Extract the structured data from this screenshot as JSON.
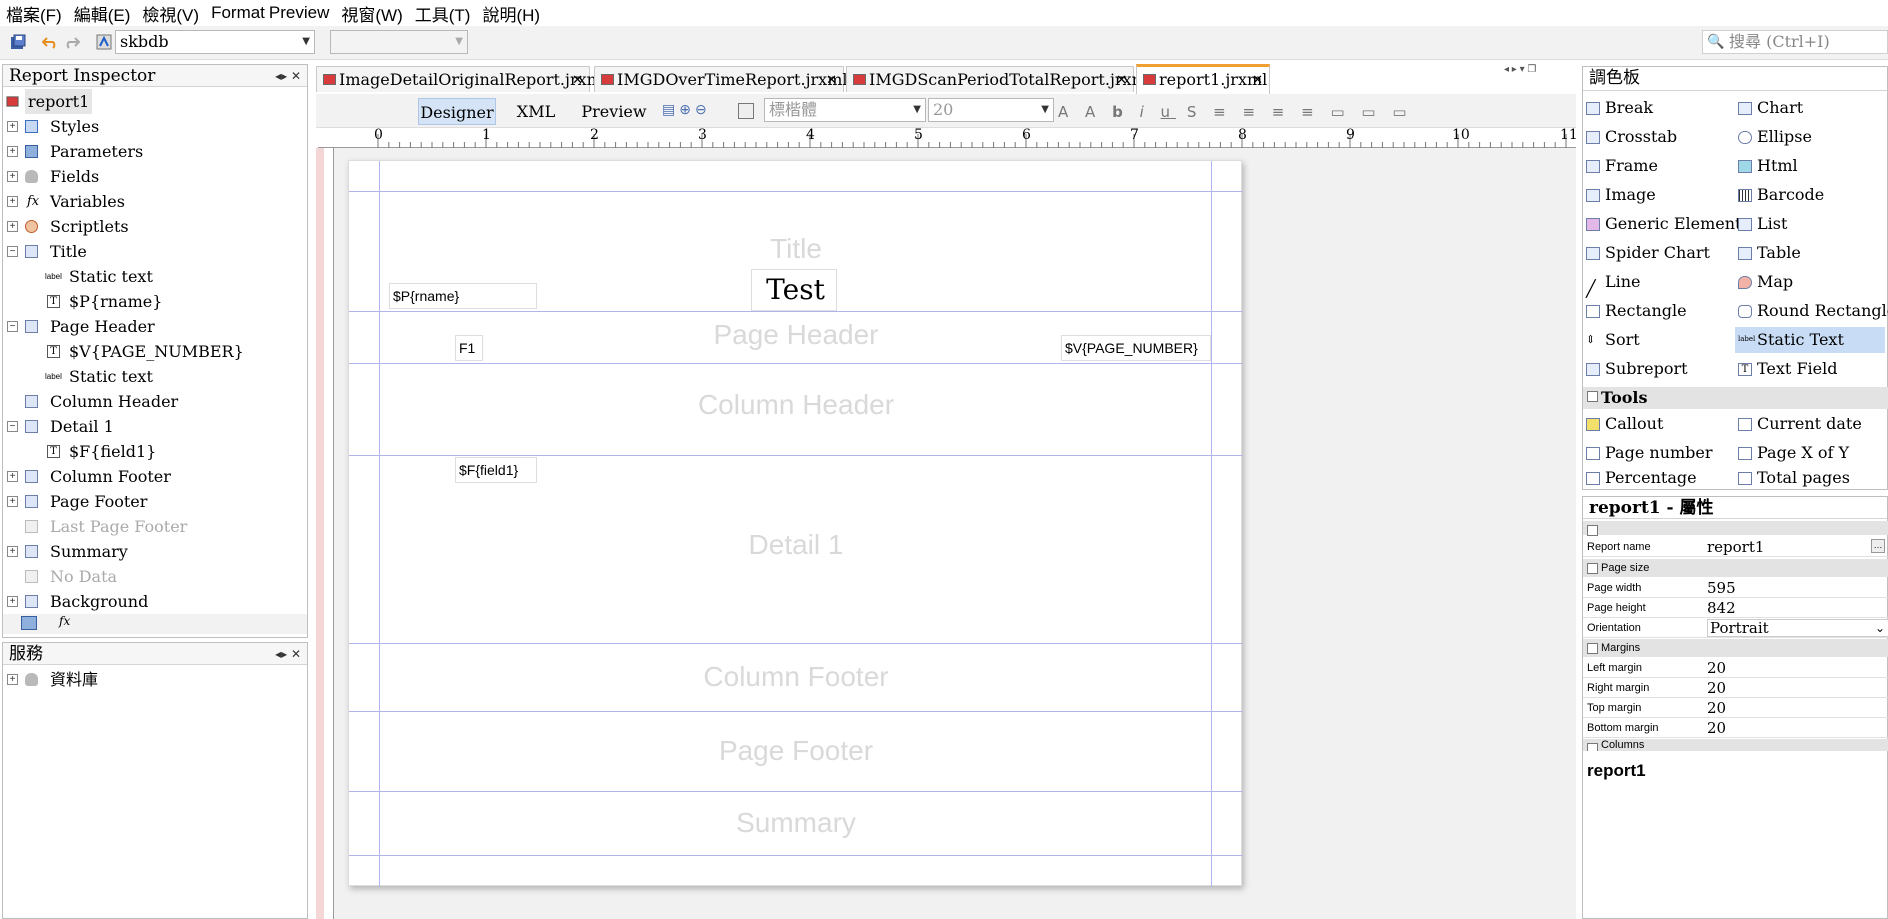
{
  "menu": [
    "檔案(F)",
    "編輯(E)",
    "檢視(V)",
    "Format",
    "Preview",
    "視窗(W)",
    "工具(T)",
    "說明(H)"
  ],
  "toolbar": {
    "datasource": "skbdb",
    "search_placeholder": "搜尋 (Ctrl+I)"
  },
  "inspector": {
    "title": "Report Inspector",
    "items": [
      "report1",
      "Styles",
      "Parameters",
      "Fields",
      "Variables",
      "Scriptlets",
      "Title",
      "Static text",
      "$P{rname}",
      "Page Header",
      "$V{PAGE_NUMBER}",
      "Static text",
      "Column Header",
      "Detail 1",
      "$F{field1}",
      "Column Footer",
      "Page Footer",
      "Last Page Footer",
      "Summary",
      "No Data",
      "Background"
    ]
  },
  "services": {
    "title": "服務",
    "items": [
      "資料庫"
    ]
  },
  "tabs": [
    "ImageDetailOriginalReport.jrxml",
    "IMGDOverTimeReport.jrxml",
    "IMGDScanPeriodTotalReport.jrxml",
    "report1.jrxml"
  ],
  "editor": {
    "designer": "Designer",
    "xml": "XML",
    "preview": "Preview",
    "font": "標楷體",
    "size": "20"
  },
  "ruler": [
    "0",
    "1",
    "2",
    "3",
    "4",
    "5",
    "6",
    "7",
    "8",
    "9",
    "10",
    "11"
  ],
  "bands": {
    "title": "Title",
    "page_header": "Page Header",
    "column_header": "Column Header",
    "detail": "Detail 1",
    "column_footer": "Column Footer",
    "page_footer": "Page Footer",
    "summary": "Summary"
  },
  "elements": {
    "rname": "$P{rname}",
    "test": "Test",
    "f1": "F1",
    "page_number": "$V{PAGE_NUMBER}",
    "field1": "$F{field1}"
  },
  "palette": {
    "title": "調色板",
    "tools_title": "Tools",
    "left": [
      "Break",
      "Crosstab",
      "Frame",
      "Image",
      "Generic Element",
      "Spider Chart",
      "Line",
      "Rectangle",
      "Sort",
      "Subreport"
    ],
    "right": [
      "Chart",
      "Ellipse",
      "Html",
      "Barcode",
      "List",
      "Table",
      "Map",
      "Round Rectangle",
      "Static Text",
      "Text Field"
    ],
    "tools_left": [
      "Callout",
      "Page number",
      "Percentage"
    ],
    "tools_right": [
      "Current date",
      "Page X of Y",
      "Total pages"
    ]
  },
  "properties": {
    "title": "report1 - 屬性",
    "report_name_label": "Report name",
    "report_name": "report1",
    "page_size": "Page size",
    "page_width_label": "Page width",
    "page_width": "595",
    "page_height_label": "Page height",
    "page_height": "842",
    "orientation_label": "Orientation",
    "orientation": "Portrait",
    "margins": "Margins",
    "left_margin_label": "Left margin",
    "left_margin": "20",
    "right_margin_label": "Right margin",
    "right_margin": "20",
    "top_margin_label": "Top margin",
    "top_margin": "20",
    "bottom_margin_label": "Bottom margin",
    "bottom_margin": "20",
    "columns": "Columns",
    "footer_name": "report1"
  }
}
